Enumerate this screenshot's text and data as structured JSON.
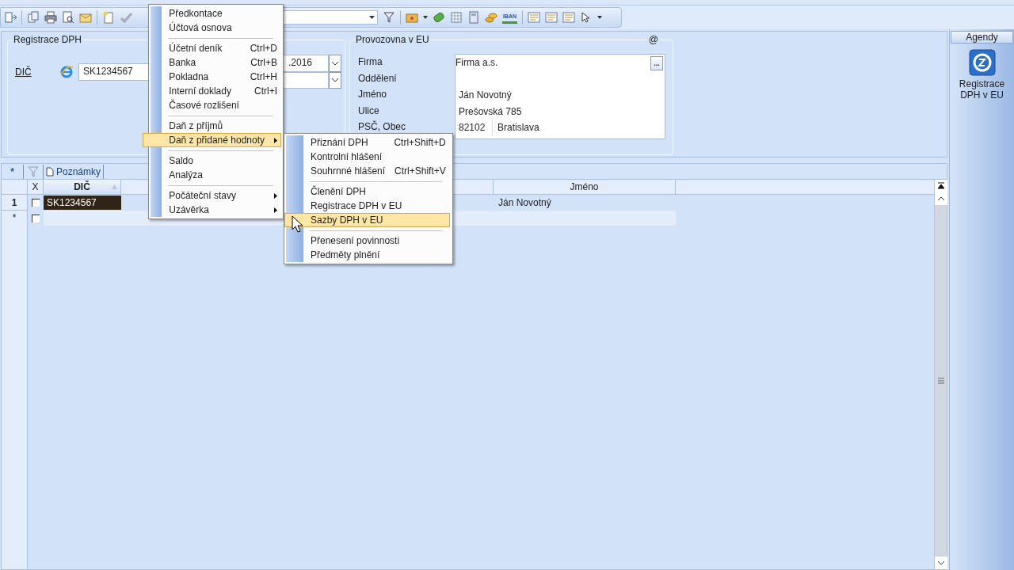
{
  "toolbar": {
    "iban_label": "IBAN"
  },
  "registration": {
    "title": "Registrace DPH",
    "dic_label": "DIČ",
    "dic_value": "SK1234567",
    "date_value": ".2016"
  },
  "establishment": {
    "title": "Provozovna v EU",
    "email_mark": "@",
    "fields": [
      {
        "label": "Firma",
        "values": [
          "Firma a.s."
        ],
        "has_button": true,
        "button_label": "..."
      },
      {
        "label": "Oddělení"
      },
      {
        "label": "Jméno",
        "values": [
          "Ján Novotný"
        ]
      },
      {
        "label": "Ulice",
        "values": [
          "Prešovská 785"
        ]
      },
      {
        "label": "PSČ, Obec",
        "values": [
          "82102",
          "Bratislava"
        ]
      }
    ]
  },
  "agendas": {
    "title": "Agendy",
    "items": [
      {
        "label": "Registrace DPH v EU",
        "selected": true
      }
    ]
  },
  "grid": {
    "new_button": "*",
    "tab": "Poznámky",
    "columns": [
      {
        "label": "X"
      },
      {
        "label": "DIČ",
        "sorted": true
      },
      {},
      {
        "label": "Jméno"
      }
    ],
    "rows": [
      {
        "header": "1",
        "checked": false,
        "dic": "SK1234567",
        "name": "Ján Novotný",
        "selected": true
      }
    ],
    "new_row_marker": "*",
    "new_row_checked": false
  },
  "menu": {
    "items": [
      {
        "kind": "item",
        "label": "Předkontace",
        "selected": false
      },
      {
        "kind": "item",
        "label": "Účtová osnova",
        "selected": false
      },
      {
        "kind": "separator"
      },
      {
        "kind": "item",
        "label": "Účetní deník",
        "shortcut": "Ctrl+D",
        "selected": false
      },
      {
        "kind": "item",
        "label": "Banka",
        "shortcut": "Ctrl+B",
        "selected": false
      },
      {
        "kind": "item",
        "label": "Pokladna",
        "shortcut": "Ctrl+H",
        "selected": false
      },
      {
        "kind": "item",
        "label": "Interní doklady",
        "shortcut": "Ctrl+I",
        "selected": false
      },
      {
        "kind": "item",
        "label": "Časové rozlišení",
        "selected": false
      },
      {
        "kind": "separator"
      },
      {
        "kind": "item",
        "label": "Daň z příjmů",
        "selected": false
      },
      {
        "kind": "item",
        "label": "Daň z přidané hodnoty",
        "submenu": true,
        "selected": true
      },
      {
        "kind": "separator"
      },
      {
        "kind": "item",
        "label": "Saldo",
        "selected": false
      },
      {
        "kind": "item",
        "label": "Analýza",
        "selected": false
      },
      {
        "kind": "separator"
      },
      {
        "kind": "item",
        "label": "Počáteční stavy",
        "submenu": true,
        "selected": false
      },
      {
        "kind": "item",
        "label": "Uzávěrka",
        "submenu": true,
        "selected": false
      }
    ]
  },
  "submenu": {
    "items": [
      {
        "kind": "item",
        "label": "Přiznání DPH",
        "shortcut": "Ctrl+Shift+D",
        "selected": false
      },
      {
        "kind": "item",
        "label": "Kontrolní hlášení",
        "selected": false
      },
      {
        "kind": "item",
        "label": "Souhrnné hlášení",
        "shortcut": "Ctrl+Shift+V",
        "selected": false
      },
      {
        "kind": "separator"
      },
      {
        "kind": "item",
        "label": "Členění DPH",
        "selected": false
      },
      {
        "kind": "item",
        "label": "Registrace DPH v EU",
        "selected": false
      },
      {
        "kind": "item",
        "label": "Sazby DPH v EU",
        "selected": true
      },
      {
        "kind": "separator"
      },
      {
        "kind": "item",
        "label": "Přenesení povinnosti",
        "selected": false
      },
      {
        "kind": "item",
        "label": "Předměty plnění",
        "selected": false
      }
    ]
  }
}
